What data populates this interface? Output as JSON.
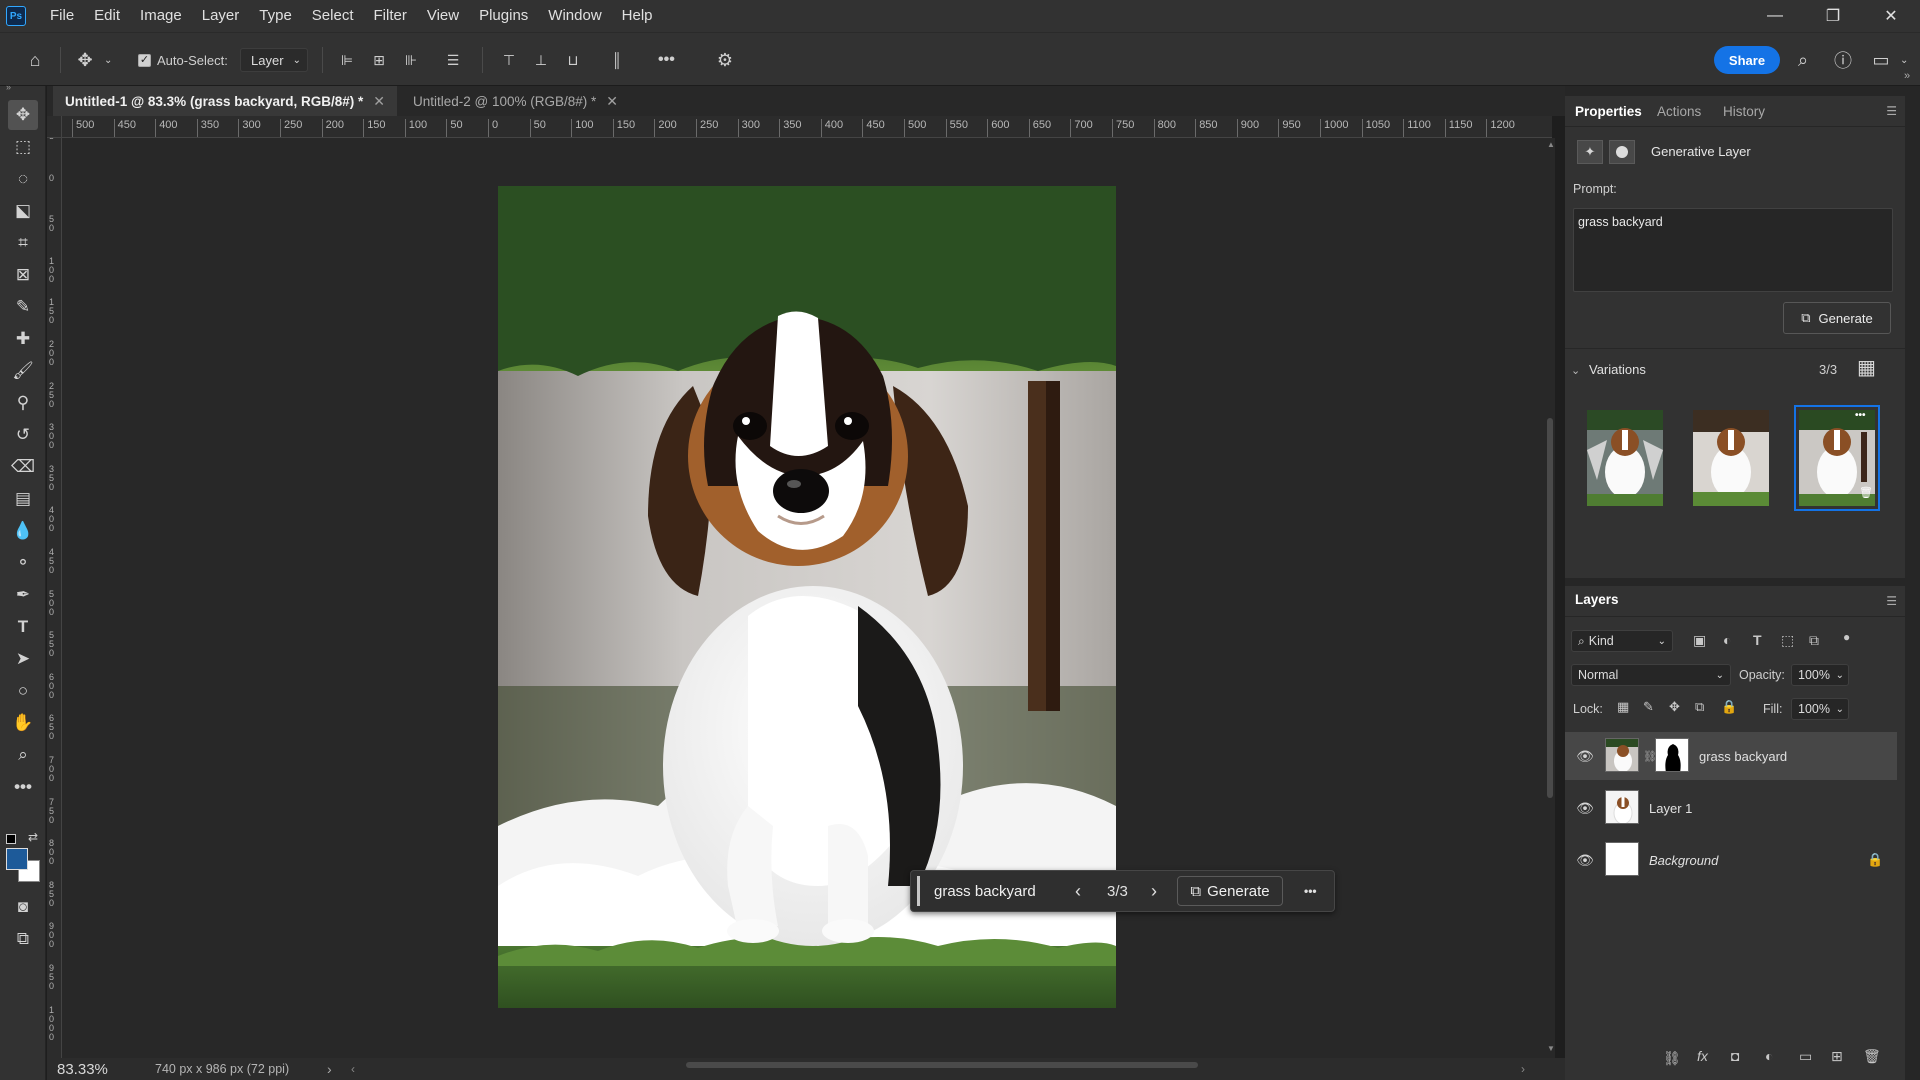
{
  "app": {
    "logo": "Ps",
    "menu": [
      "File",
      "Edit",
      "Image",
      "Layer",
      "Type",
      "Select",
      "Filter",
      "View",
      "Plugins",
      "Window",
      "Help"
    ]
  },
  "options_bar": {
    "auto_select_label": "Auto-Select:",
    "layer_select_value": "Layer",
    "more_label": "•••",
    "share_label": "Share"
  },
  "tabs": [
    {
      "label": "Untitled-1 @ 83.3% (grass backyard, RGB/8#) *"
    },
    {
      "label": "Untitled-2 @ 100% (RGB/8#) *"
    }
  ],
  "rulers": {
    "top": [
      "500",
      "450",
      "400",
      "350",
      "300",
      "250",
      "200",
      "150",
      "100",
      "50",
      "0",
      "50",
      "100",
      "150",
      "200",
      "250",
      "300",
      "350",
      "400",
      "450",
      "500",
      "550",
      "600",
      "650",
      "700",
      "750",
      "800",
      "850",
      "900",
      "950",
      "1000",
      "1050",
      "1100",
      "1150",
      "1200"
    ],
    "left": [
      "5",
      "0",
      "5\n0",
      "1\n0\n0",
      "1\n5\n0",
      "2\n0\n0",
      "2\n5\n0",
      "3\n0\n0",
      "3\n5\n0",
      "4\n0\n0",
      "4\n5\n0",
      "5\n0\n0",
      "5\n5\n0",
      "6\n0\n0",
      "6\n5\n0",
      "7\n0\n0",
      "7\n5\n0",
      "8\n0\n0",
      "8\n5\n0",
      "9\n0\n0",
      "9\n5\n0",
      "1\n0\n0\n0"
    ]
  },
  "context_bar": {
    "prompt": "grass backyard",
    "counter": "3/3",
    "generate_label": "Generate",
    "more_label": "•••"
  },
  "status": {
    "zoom": "83.33%",
    "dimensions": "740 px x 986 px (72 ppi)"
  },
  "properties": {
    "tabs": [
      "Properties",
      "Actions",
      "History"
    ],
    "layer_type": "Generative Layer",
    "prompt_label": "Prompt:",
    "prompt_value": "grass backyard",
    "generate_label": "Generate",
    "variations_label": "Variations",
    "variations_count": "3/3",
    "selected_variation": 3
  },
  "layers": {
    "title": "Layers",
    "kind_label": "Kind",
    "blend_mode": "Normal",
    "opacity_label": "Opacity:",
    "opacity_value": "100%",
    "lock_label": "Lock:",
    "fill_label": "Fill:",
    "fill_value": "100%",
    "items": [
      {
        "name": "grass backyard",
        "selected": true
      },
      {
        "name": "Layer 1",
        "selected": false
      },
      {
        "name": "Background",
        "selected": false
      }
    ]
  },
  "colors": {
    "accent": "#1473e6",
    "foreground_swatch": "#1d5a99",
    "background_swatch": "#ffffff"
  }
}
